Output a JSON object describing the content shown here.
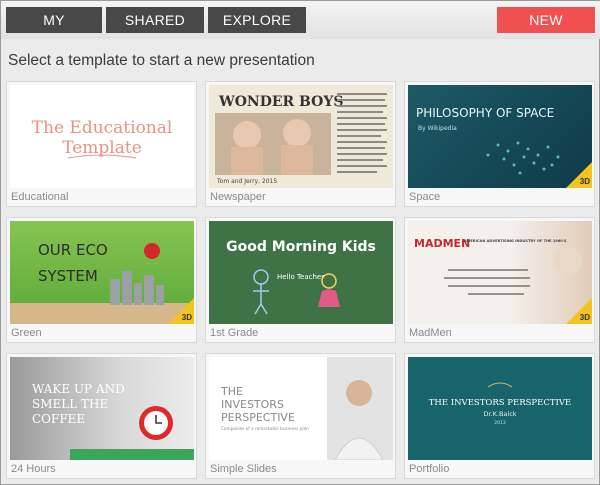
{
  "nav": {
    "tabs": [
      "MY",
      "SHARED",
      "EXPLORE"
    ],
    "new_label": "NEW",
    "new_color": "#f05050"
  },
  "heading": "Select a template to start a new presentation",
  "templates": [
    {
      "name": "Educational",
      "text": [
        "The Educational",
        "Template"
      ],
      "badge": ""
    },
    {
      "name": "Newspaper",
      "text": [
        "WONDER BOYS",
        "Tom and Jerry, 2015"
      ],
      "badge": ""
    },
    {
      "name": "Space",
      "text": [
        "PHILOSOPHY OF SPACE",
        "By Wikipedia"
      ],
      "badge": "3D"
    },
    {
      "name": "Green",
      "text": [
        "OUR ECO",
        "SYSTEM"
      ],
      "badge": "3D"
    },
    {
      "name": "1st Grade",
      "text": [
        "Good Morning Kids",
        "Hello Teacher"
      ],
      "badge": ""
    },
    {
      "name": "MadMen",
      "text": [
        "MADMEN",
        "AMERICAN ADVERTISING INDUSTRY OF THE 1960'S"
      ],
      "badge": "3D"
    },
    {
      "name": "24 Hours",
      "text": [
        "WAKE UP AND",
        "SMELL THE",
        "COFFEE"
      ],
      "badge": ""
    },
    {
      "name": "Simple Slides",
      "text": [
        "THE",
        "INVESTORS",
        "PERSPECTIVE",
        "Companies of a remarkable business plan"
      ],
      "badge": ""
    },
    {
      "name": "Portfolio",
      "text": [
        "THE INVESTORS PERSPECTIVE",
        "Dr.K.Balck",
        "2013"
      ],
      "badge": ""
    }
  ]
}
